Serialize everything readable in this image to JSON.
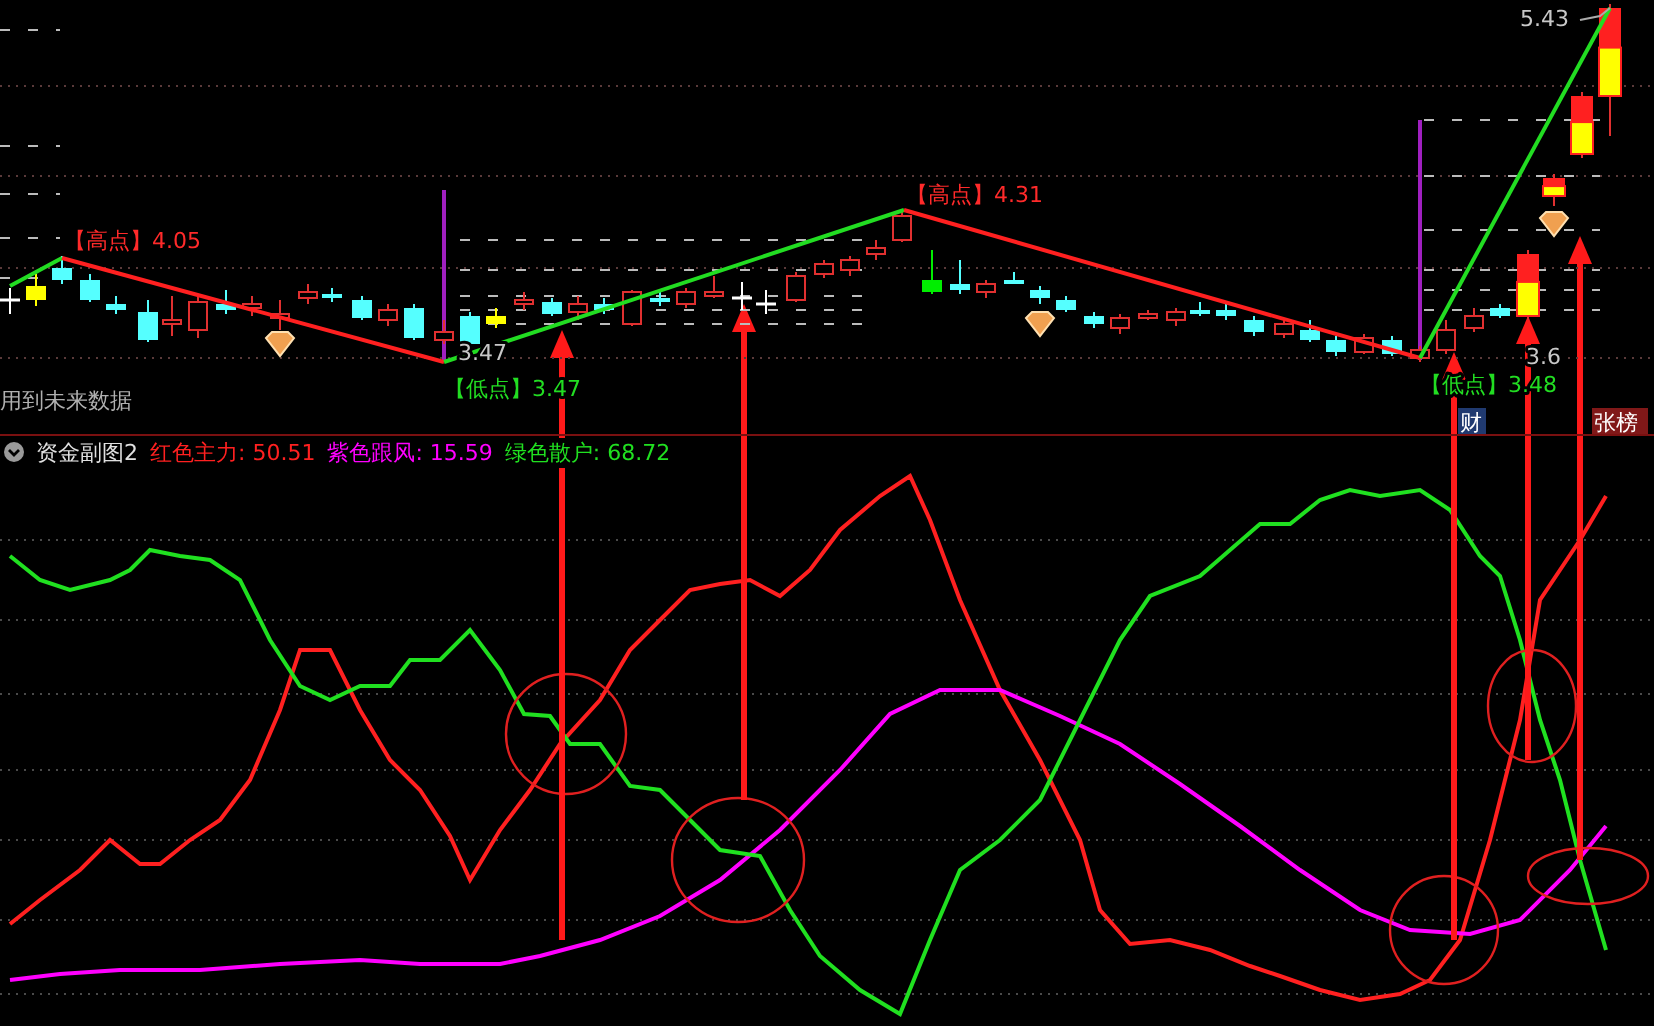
{
  "chart_labels": [
    {
      "text": "【高点】4.05",
      "kind": "high"
    },
    {
      "text": "3.47",
      "kind": "price"
    },
    {
      "text": "【低点】3.47",
      "kind": "low"
    },
    {
      "text": "【高点】4.31",
      "kind": "high"
    },
    {
      "text": "【低点】3.48",
      "kind": "low"
    },
    {
      "text": "5.43",
      "kind": "price"
    },
    {
      "text": "3.6",
      "kind": "price"
    }
  ],
  "note": "用到未来数据",
  "tags": [
    {
      "text": "财",
      "kind": "finance"
    },
    {
      "text": "张榜",
      "kind": "ranking"
    }
  ],
  "indicator": {
    "title": "资金副图2",
    "series": [
      {
        "label": "红色主力: 50.51",
        "color": "#ff2020"
      },
      {
        "label": "紫色跟风: 15.59",
        "color": "#ff00ff"
      },
      {
        "label": "绿色散户: 68.72",
        "color": "#20e020"
      }
    ]
  }
}
